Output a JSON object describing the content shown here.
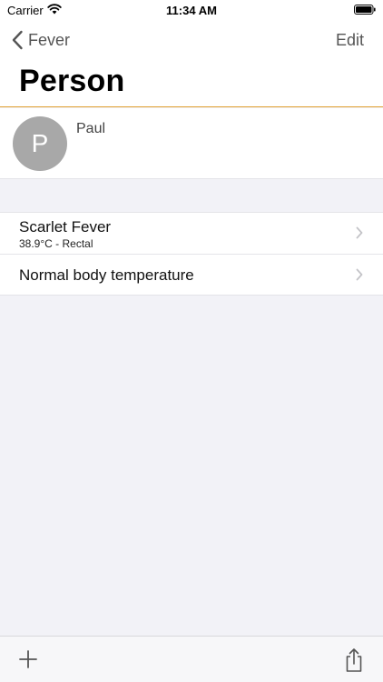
{
  "status_bar": {
    "carrier": "Carrier",
    "time": "11:34 AM"
  },
  "nav": {
    "back_label": "Fever",
    "edit_label": "Edit",
    "title": "Person"
  },
  "person": {
    "avatar_initial": "P",
    "name": "Paul"
  },
  "list": {
    "items": [
      {
        "title": "Scarlet Fever",
        "subtitle": "38.9°C - Rectal"
      },
      {
        "title": "Normal body temperature"
      }
    ]
  },
  "icons": {
    "back": "chevron-left-icon",
    "disclosure": "chevron-right-icon",
    "add": "plus-icon",
    "share": "share-icon",
    "wifi": "wifi-icon",
    "battery": "battery-icon"
  },
  "colors": {
    "accent_line": "#e0a030",
    "avatar_bg": "#a8a8a8",
    "background": "#f2f2f7"
  }
}
